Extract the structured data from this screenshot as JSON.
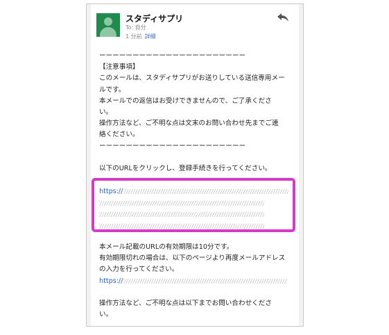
{
  "email": {
    "sender": "スタディサプリ",
    "to": "To: 自分",
    "time": "1 分前",
    "details_link": "詳細"
  },
  "body": {
    "dashes": "ーーーーーーーーーーーーーーーーーーーーーー",
    "notice_title": "【注意事項】",
    "notice_lines": [
      "このメールは、スタディサプリがお送りしている送信専用メー",
      "ルです。",
      "本メールでの返信はお受けできませんので、ご了承くださ",
      "い。",
      "操作方法など、ご不明な点は文末のお問い合わせ先までご連",
      "絡ください。"
    ],
    "instruction": "以下のURLをクリックし、登録手続きを行ってください。",
    "url_prefix": "https://",
    "expiry_lines": [
      "本メール記載のURLの有効期限は10分です。",
      "有効期限切れの場合は、以下のページより再度メールアドレス",
      "の入力を行ってください。"
    ],
    "url2_prefix": "https://",
    "contact_lines": [
      "操作方法など、ご不明な点は以下までお問い合わせくださ",
      "い。"
    ]
  },
  "colors": {
    "avatar": "#1e8a4c",
    "link": "#2a63c9",
    "highlight": "#d43ac7"
  },
  "icons": {
    "reply": "reply-icon",
    "avatar": "avatar-icon"
  }
}
